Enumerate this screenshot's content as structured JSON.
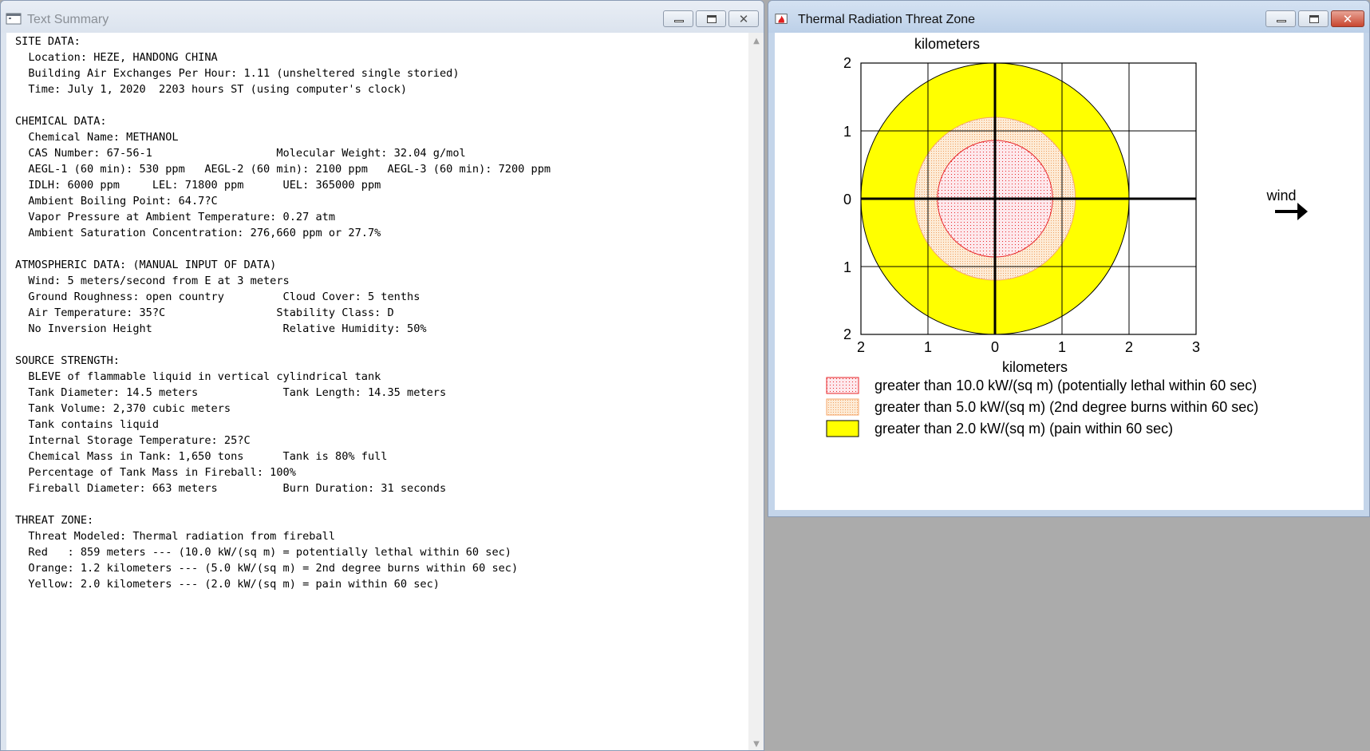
{
  "text_window": {
    "title": "Text Summary",
    "lines": [
      "SITE DATA:",
      "  Location: HEZE, HANDONG CHINA",
      "  Building Air Exchanges Per Hour: 1.11 (unsheltered single storied)",
      "  Time: July 1, 2020  2203 hours ST (using computer's clock)",
      "",
      "CHEMICAL DATA:",
      "  Chemical Name: METHANOL",
      "  CAS Number: 67-56-1                   Molecular Weight: 32.04 g/mol",
      "  AEGL-1 (60 min): 530 ppm   AEGL-2 (60 min): 2100 ppm   AEGL-3 (60 min): 7200 ppm",
      "  IDLH: 6000 ppm     LEL: 71800 ppm      UEL: 365000 ppm",
      "  Ambient Boiling Point: 64.7?C",
      "  Vapor Pressure at Ambient Temperature: 0.27 atm",
      "  Ambient Saturation Concentration: 276,660 ppm or 27.7%",
      "",
      "ATMOSPHERIC DATA: (MANUAL INPUT OF DATA)",
      "  Wind: 5 meters/second from E at 3 meters",
      "  Ground Roughness: open country         Cloud Cover: 5 tenths",
      "  Air Temperature: 35?C                 Stability Class: D",
      "  No Inversion Height                    Relative Humidity: 50%",
      "",
      "SOURCE STRENGTH:",
      "  BLEVE of flammable liquid in vertical cylindrical tank",
      "  Tank Diameter: 14.5 meters             Tank Length: 14.35 meters",
      "  Tank Volume: 2,370 cubic meters",
      "  Tank contains liquid",
      "  Internal Storage Temperature: 25?C",
      "  Chemical Mass in Tank: 1,650 tons      Tank is 80% full",
      "  Percentage of Tank Mass in Fireball: 100%",
      "  Fireball Diameter: 663 meters          Burn Duration: 31 seconds",
      "",
      "THREAT ZONE:",
      "  Threat Modeled: Thermal radiation from fireball",
      "  Red   : 859 meters --- (10.0 kW/(sq m) = potentially lethal within 60 sec)",
      "  Orange: 1.2 kilometers --- (5.0 kW/(sq m) = 2nd degree burns within 60 sec)",
      "  Yellow: 2.0 kilometers --- (2.0 kW/(sq m) = pain within 60 sec)"
    ]
  },
  "threat_window": {
    "title": "Thermal Radiation Threat Zone",
    "wind_label": "wind"
  },
  "chart_data": {
    "type": "threat-zone",
    "ylabel": "kilometers",
    "xlabel": "kilometers",
    "xlim": [
      -2,
      3
    ],
    "ylim": [
      -2,
      2
    ],
    "x_tick_labels": [
      "2",
      "1",
      "0",
      "1",
      "2",
      "3"
    ],
    "y_tick_labels": [
      "2",
      "1",
      "0",
      "1",
      "2"
    ],
    "grid": true,
    "zones": [
      {
        "name": "red",
        "radius_km": 0.859,
        "fill": "#fde6ea",
        "stroke": "#e8262a",
        "pattern": "dots-red",
        "legend": "greater than 10.0 kW/(sq m) (potentially lethal within 60 sec)"
      },
      {
        "name": "orange",
        "radius_km": 1.2,
        "fill": "#fde6cc",
        "stroke": "#f5a66a",
        "pattern": "dots-orange",
        "legend": "greater than 5.0 kW/(sq m) (2nd degree burns within 60 sec)"
      },
      {
        "name": "yellow",
        "radius_km": 2.0,
        "fill": "#ffff00",
        "stroke": "#000000",
        "pattern": "solid",
        "legend": "greater than 2.0 kW/(sq m) (pain within 60 sec)"
      }
    ]
  }
}
